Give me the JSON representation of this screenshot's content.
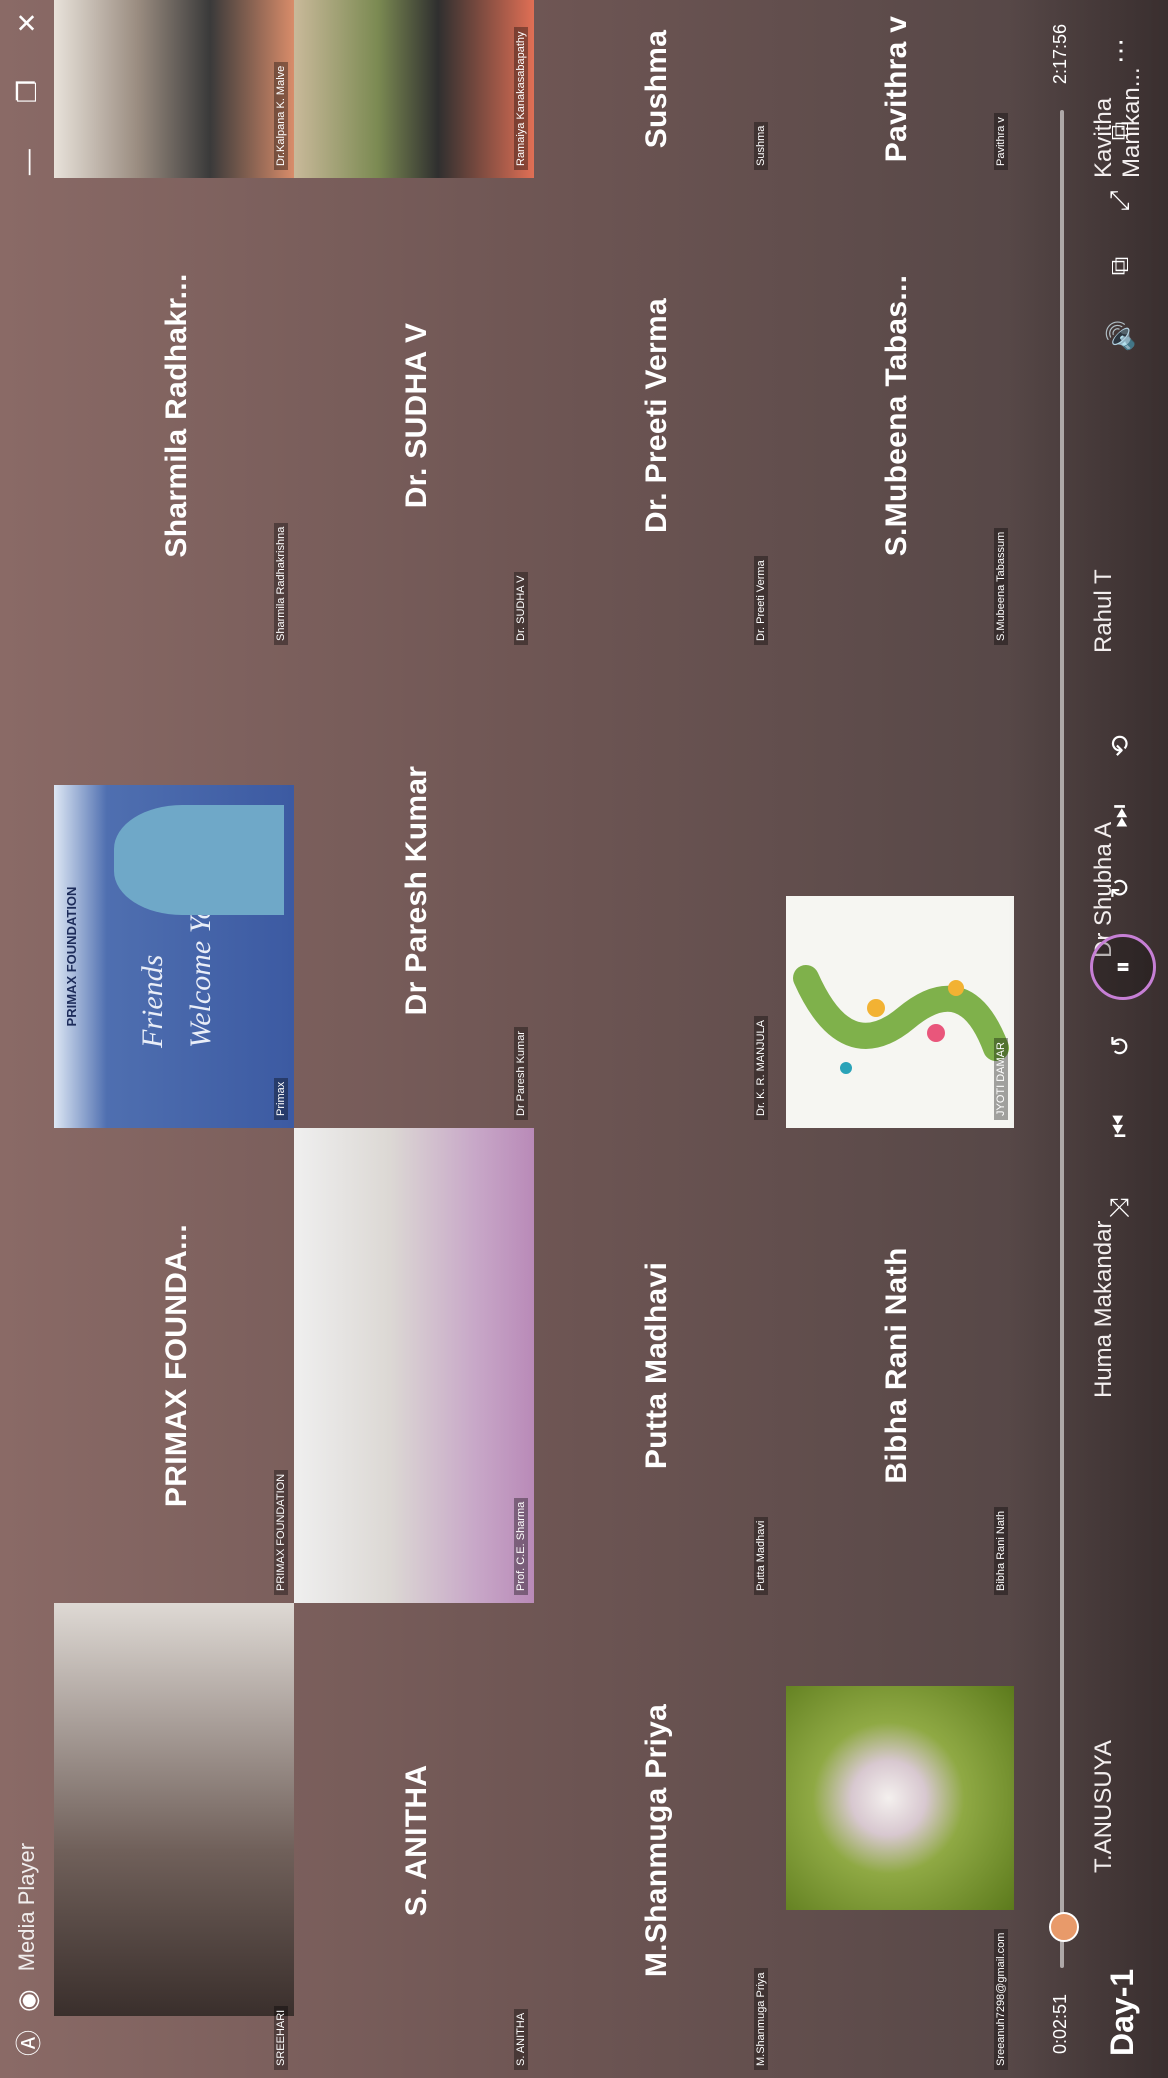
{
  "window": {
    "title": "Media Player"
  },
  "tiles": [
    {
      "name": "",
      "label": "SREEHARI",
      "kind": "video"
    },
    {
      "name": "S. ANITHA",
      "label": "S. ANITHA",
      "kind": "name"
    },
    {
      "name": "M.Shanmuga Priya",
      "label": "M.Shanmuga Priya",
      "kind": "name"
    },
    {
      "name": "",
      "label": "Sreeanuh7298@gmail.com",
      "kind": "image"
    },
    {
      "name": "PRIMAX FOUNDA...",
      "label": "PRIMAX FOUNDATION",
      "kind": "name"
    },
    {
      "name": "",
      "label": "Prof. C.E. Sharma",
      "kind": "video"
    },
    {
      "name": "Putta Madhavi",
      "label": "Putta Madhavi",
      "kind": "name"
    },
    {
      "name": "Bibha Rani Nath",
      "label": "Bibha Rani Nath",
      "kind": "name"
    },
    {
      "name": "",
      "label": "Primax",
      "kind": "welcome"
    },
    {
      "name": "Dr Paresh Kumar",
      "label": "Dr Paresh Kumar",
      "kind": "name"
    },
    {
      "name": "",
      "label": "Dr. K. R. MANJULA",
      "kind": "blank"
    },
    {
      "name": "",
      "label": "JYOTI DAMAR",
      "kind": "image"
    },
    {
      "name": "Sharmila Radhakr...",
      "label": "Sharmila Radhakrishna",
      "kind": "name"
    },
    {
      "name": "Dr. SUDHA V",
      "label": "Dr. SUDHA V",
      "kind": "name"
    },
    {
      "name": "Dr. Preeti Verma",
      "label": "Dr. Preeti Verma",
      "kind": "name"
    },
    {
      "name": "S.Mubeena Tabas...",
      "label": "S.Mubeena Tabassum",
      "kind": "name"
    },
    {
      "name": "",
      "label": "Dr.Kalpana K. Malve",
      "kind": "video"
    },
    {
      "name": "",
      "label": "Ramaiya Kanakasabapathy",
      "kind": "video"
    },
    {
      "name": "Sushma",
      "label": "Sushma",
      "kind": "name"
    },
    {
      "name": "Pavithra v",
      "label": "Pavithra v",
      "kind": "name"
    }
  ],
  "welcome": {
    "org": "PRIMAX FOUNDATION",
    "text1": "Friends",
    "text2": "Welcome You"
  },
  "player": {
    "current_time": "0:02:51",
    "total_time": "2:17:56",
    "progress": 0.021,
    "media_title": "Day-1",
    "bottom_names": [
      "T.ANUSUYA",
      "Huma Makandar",
      "Dr Shubha A",
      "Rahul T",
      "Kavitha Manikan..."
    ]
  }
}
